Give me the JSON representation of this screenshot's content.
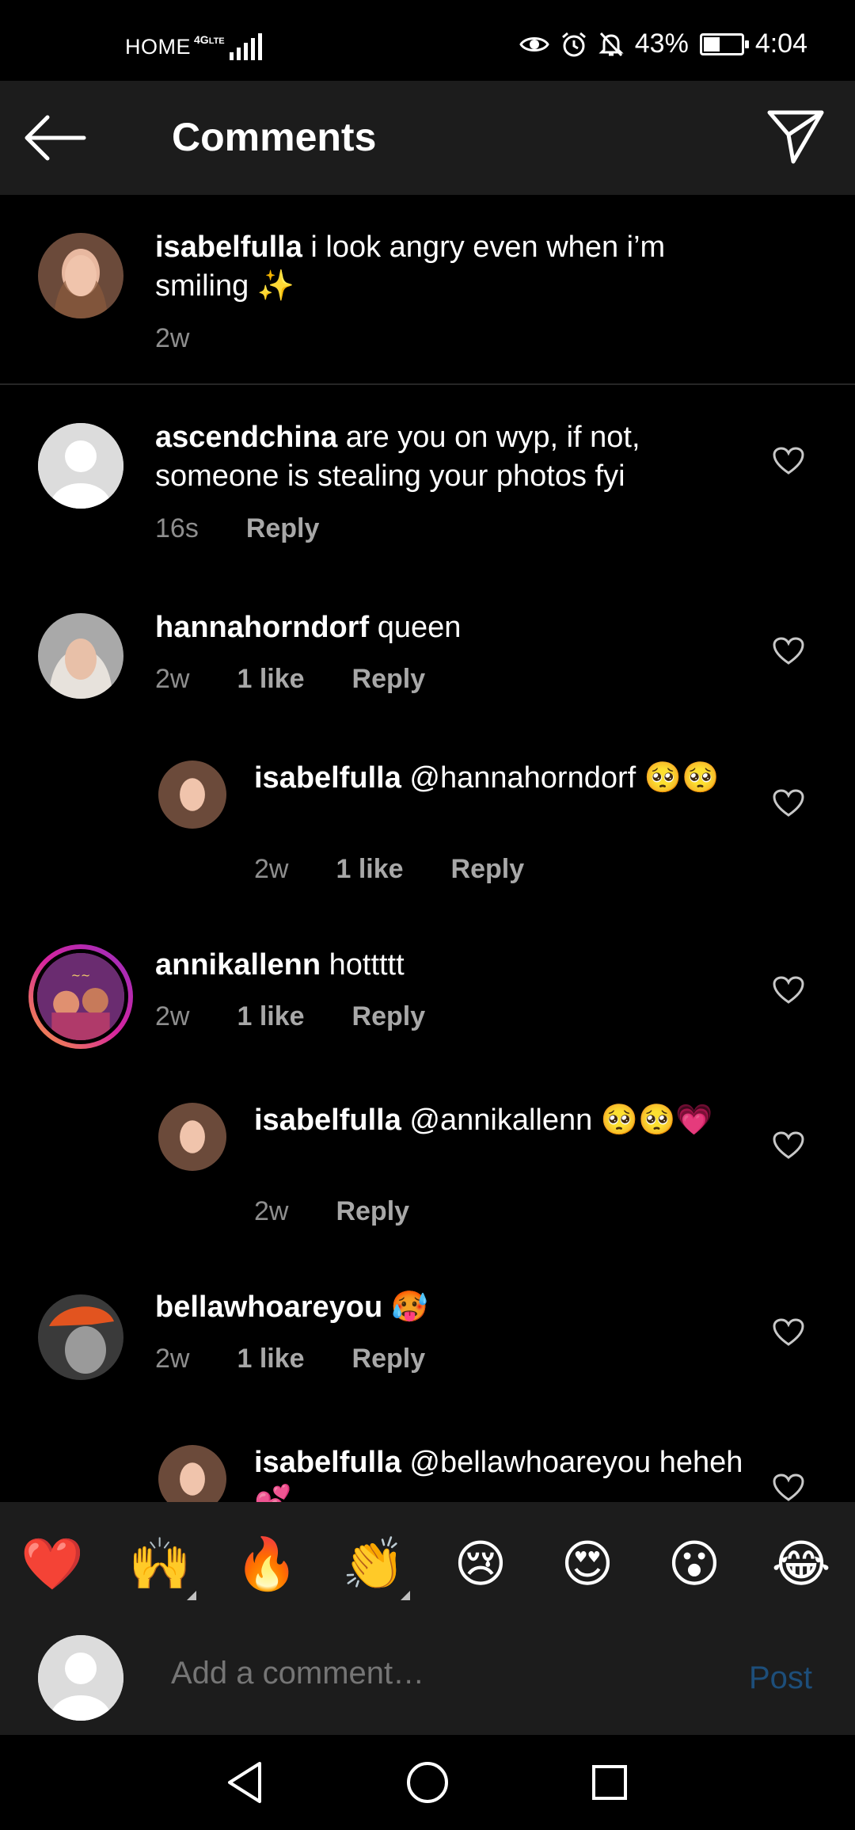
{
  "status_bar": {
    "carrier": "HOME",
    "network": "4G",
    "network_sub": "LTE",
    "battery": "43%",
    "battery_level": 0.43,
    "time": "4:04",
    "icons": [
      "eye-icon",
      "alarm-icon",
      "mute-icon"
    ]
  },
  "header": {
    "title": "Comments",
    "back_icon": "arrow-left-icon",
    "share_icon": "paper-plane-icon"
  },
  "caption": {
    "username": "isabelfulla",
    "text": " i look angry even when i’m smiling ✨",
    "time": "2w"
  },
  "comments": [
    {
      "username": "ascendchina",
      "text": " are you on wyp, if not, someone is stealing your photos fyi",
      "time": "16s",
      "likes": "",
      "reply": "Reply"
    },
    {
      "username": "hannahorndorf",
      "text": " queen",
      "time": "2w",
      "likes": "1 like",
      "reply": "Reply"
    },
    {
      "username": "isabelfulla",
      "text": " @hannahorndorf 🥺🥺",
      "time": "2w",
      "likes": "1 like",
      "reply": "Reply"
    },
    {
      "username": "annikallenn",
      "text": " hottttt",
      "time": "2w",
      "likes": "1 like",
      "reply": "Reply"
    },
    {
      "username": "isabelfulla",
      "text": " @annikallenn 🥺🥺💗",
      "time": "2w",
      "likes": "",
      "reply": "Reply"
    },
    {
      "username": "bellawhoareyou",
      "text": " 🥵",
      "time": "2w",
      "likes": "1 like",
      "reply": "Reply"
    },
    {
      "username": "isabelfulla",
      "text": " @bellawhoareyou heheh💕",
      "time": "",
      "likes": "",
      "reply": ""
    }
  ],
  "emoji_bar": [
    "❤️",
    "🙌",
    "🔥",
    "👏",
    "😢",
    "😍",
    "😮",
    "😂"
  ],
  "input": {
    "placeholder": "Add a comment…",
    "post_label": "Post"
  },
  "nav": [
    "back-triangle-icon",
    "home-circle-icon",
    "recents-square-icon"
  ],
  "colors": {
    "background": "#000000",
    "bar": "#1c1c1c",
    "secondary_text": "#8e8e8e",
    "post_disabled": "#1d4e7a"
  }
}
